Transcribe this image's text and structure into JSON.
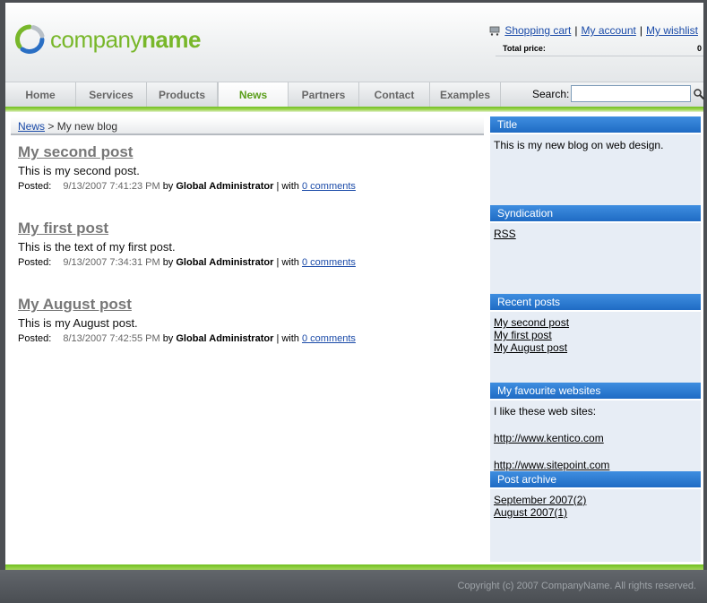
{
  "header": {
    "logo_light": "company",
    "logo_bold": "name",
    "links": {
      "shopping_cart": "Shopping cart",
      "my_account": "My account",
      "my_wishlist": "My wishlist",
      "separator": "|"
    },
    "total_price_label": "Total price:",
    "total_price_value": "0"
  },
  "nav": {
    "items": [
      {
        "label": "Home"
      },
      {
        "label": "Services"
      },
      {
        "label": "Products"
      },
      {
        "label": "News"
      },
      {
        "label": "Partners"
      },
      {
        "label": "Contact"
      },
      {
        "label": "Examples"
      }
    ],
    "active": "News",
    "search_label": "Search:",
    "search_value": ""
  },
  "breadcrumb": {
    "link": "News",
    "separator": ">",
    "current": "My new blog"
  },
  "posts": [
    {
      "title": "My second post",
      "body": "This is my second post.",
      "posted_label": "Posted:",
      "date": "9/13/2007 7:41:23 PM",
      "by": "by",
      "author": "Global Administrator",
      "with": "| with",
      "comments": "0 comments"
    },
    {
      "title": "My first post",
      "body": "This is the text of my first post.",
      "posted_label": "Posted:",
      "date": "9/13/2007 7:34:31 PM",
      "by": "by",
      "author": "Global Administrator",
      "with": "| with",
      "comments": "0 comments"
    },
    {
      "title": "My August post",
      "body": "This is my August post.",
      "posted_label": "Posted:",
      "date": "8/13/2007 7:42:55 PM",
      "by": "by",
      "author": "Global Administrator",
      "with": "| with",
      "comments": "0 comments"
    }
  ],
  "sidebar": {
    "title_box": {
      "title": "Title",
      "text": "This is my new blog on web design."
    },
    "syndication": {
      "title": "Syndication",
      "rss": "RSS"
    },
    "recent_posts": {
      "title": "Recent posts",
      "items": [
        "My second post",
        "My first post",
        "My August post"
      ]
    },
    "favourites": {
      "title": "My favourite websites",
      "intro": "I like these web sites:",
      "link1": "http://www.kentico.com",
      "link2": "http://www.sitepoint.com"
    },
    "archive": {
      "title": "Post archive",
      "items": [
        "September 2007(2)",
        "August 2007(1)"
      ]
    }
  },
  "footer": {
    "copyright": "Copyright (c) 2007 CompanyName. All rights reserved."
  },
  "colors": {
    "accent_green": "#78b72a",
    "box_blue": "#2a7bd4",
    "link_blue": "#1a4aa8"
  }
}
